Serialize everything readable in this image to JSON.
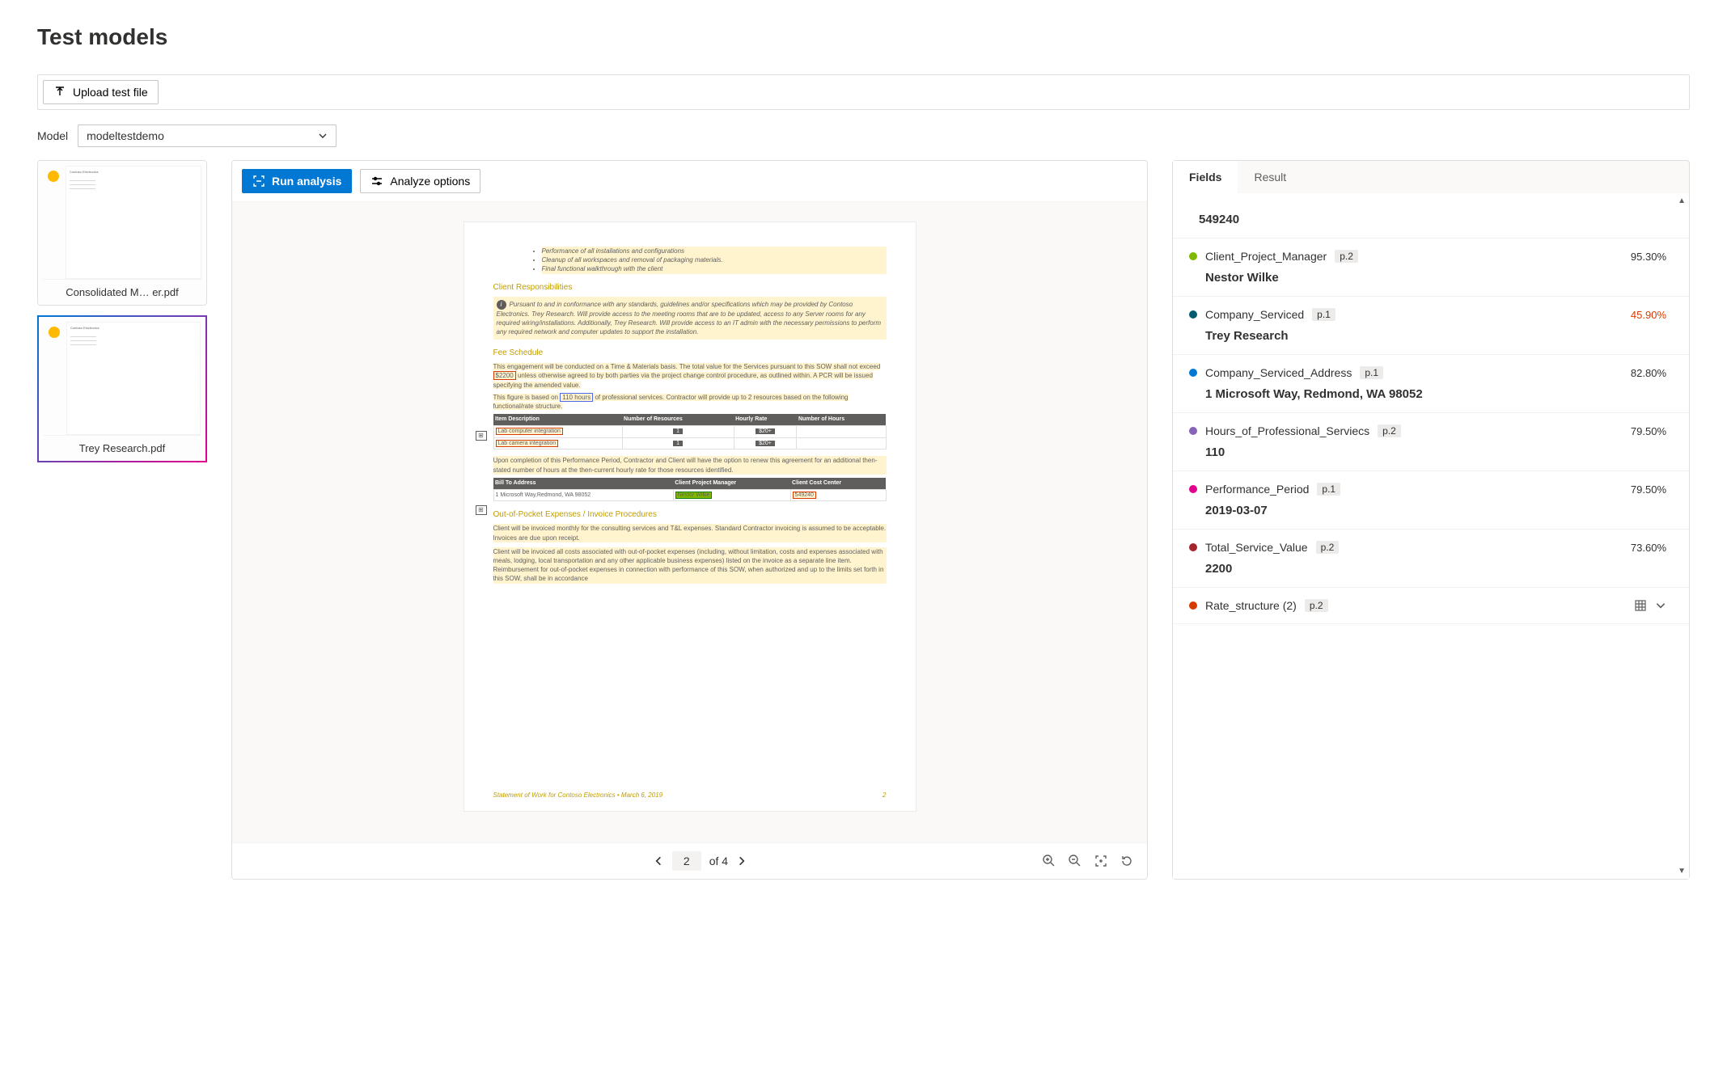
{
  "page_title": "Test models",
  "upload_button": "Upload test file",
  "model": {
    "label": "Model",
    "selected": "modeltestdemo"
  },
  "thumbnails": [
    {
      "name": "Consolidated M… er.pdf",
      "selected": false
    },
    {
      "name": "Trey Research.pdf",
      "selected": true
    }
  ],
  "viewer_toolbar": {
    "run_analysis": "Run analysis",
    "analyze_options": "Analyze options"
  },
  "pager": {
    "current": "2",
    "of_label": "of 4"
  },
  "document_preview": {
    "bullets": [
      "Performance of all installations and configurations",
      "Cleanup of all workspaces and removal of packaging materials.",
      "Final functional walkthrough with the client"
    ],
    "section_client_resp": "Client Responsibilities",
    "client_resp_text": "Pursuant to and in conformance with any standards, guidelines and/or specifications which may be provided by Contoso Electronics. Trey Research. Will provide access to the meeting rooms that are to be updated, access to any Server rooms for any required wiring/installations. Additionally, Trey Research. Will provide access to an IT admin with the necessary permissions to perform any required network and computer updates to support the installation.",
    "section_fee": "Fee Schedule",
    "fee_text_1a": "This engagement will be conducted on a Time & Materials basis. The total value for the Services pursuant to this SOW shall not exceed ",
    "fee_highlight_1": "$2200",
    "fee_text_1b": " unless otherwise agreed to by both parties via the project change control procedure, as outlined within. A PCR will be issued specifying the amended value.",
    "fee_text_2a": "This figure is based on ",
    "fee_highlight_2": "110 hours",
    "fee_text_2b": " of professional services. Contractor will provide up to 2 resources based on the following functional/rate structure.",
    "rate_table": {
      "headers": [
        "Item Description",
        "Number of Resources",
        "Hourly Rate",
        "Number of Hours"
      ],
      "rows": [
        [
          "Lab computer integration",
          "1",
          "$20+",
          ""
        ],
        [
          "Lab camera integration",
          "1",
          "$20+",
          ""
        ]
      ]
    },
    "completion_text": "Upon completion of this Performance Period, Contractor and Client will have the option to renew this agreement for an additional then-stated number of hours at the then-current hourly rate for those resources identified.",
    "bill_table": {
      "headers": [
        "Bill To Address",
        "Client Project Manager",
        "Client Cost Center"
      ],
      "rows": [
        [
          "1 Microsoft Way,Redmond, WA 98052",
          "Nestor Wilke",
          "549240"
        ]
      ]
    },
    "section_oop": "Out-of-Pocket Expenses / Invoice Procedures",
    "oop_text_1": "Client will be invoiced monthly for the consulting services and T&L expenses. Standard Contractor invoicing is assumed to be acceptable. Invoices are due upon receipt.",
    "oop_text_2": "Client will be invoiced all costs associated with out-of-pocket expenses (including, without limitation, costs and expenses associated with meals, lodging, local transportation and any other applicable business expenses) listed on the invoice as a separate line item. Reimbursement for out-of-pocket expenses in connection with performance of this SOW, when authorized and up to the limits set forth in this SOW, shall be in accordance",
    "footer_left": "Statement of Work for Contoso Electronics • March 6, 2019",
    "footer_right": "2"
  },
  "tabs": {
    "fields": "Fields",
    "result": "Result",
    "active": "fields"
  },
  "top_value": "549240",
  "fields": [
    {
      "color": "#7fba00",
      "name": "Client_Project_Manager",
      "page": "p.2",
      "confidence": "95.30%",
      "low": false,
      "value": "Nestor Wilke"
    },
    {
      "color": "#005b70",
      "name": "Company_Serviced",
      "page": "p.1",
      "confidence": "45.90%",
      "low": true,
      "value": "Trey Research"
    },
    {
      "color": "#0078d4",
      "name": "Company_Serviced_Address",
      "page": "p.1",
      "confidence": "82.80%",
      "low": false,
      "value": "1 Microsoft Way, Redmond, WA 98052"
    },
    {
      "color": "#8764b8",
      "name": "Hours_of_Professional_Serviecs",
      "page": "p.2",
      "confidence": "79.50%",
      "low": false,
      "value": "110"
    },
    {
      "color": "#e3008c",
      "name": "Performance_Period",
      "page": "p.1",
      "confidence": "79.50%",
      "low": false,
      "value": "2019-03-07"
    },
    {
      "color": "#a4262c",
      "name": "Total_Service_Value",
      "page": "p.2",
      "confidence": "73.60%",
      "low": false,
      "value": "2200"
    }
  ],
  "rate_structure_row": {
    "color": "#d83b01",
    "name": "Rate_structure (2)",
    "page": "p.2"
  }
}
